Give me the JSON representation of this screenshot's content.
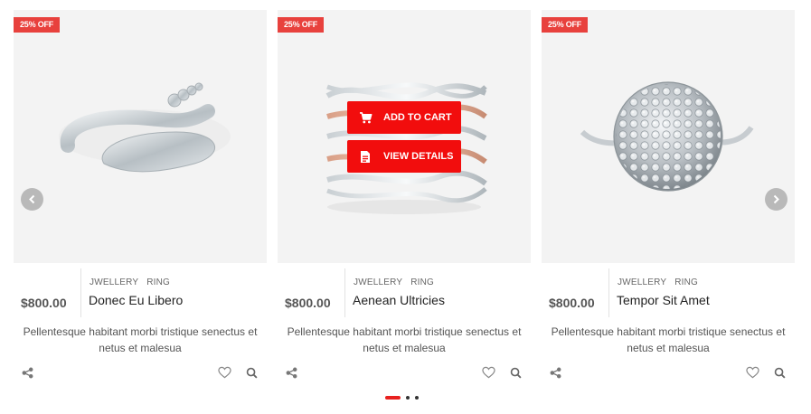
{
  "products": [
    {
      "badge": "25% OFF",
      "price": "$800.00",
      "categories": [
        "JWELLERY",
        "RING"
      ],
      "name": "Donec Eu Libero",
      "description": "Pellentesque habitant morbi tristique senectus et netus et malesua",
      "image": "silver-snake-ring"
    },
    {
      "badge": "25% OFF",
      "price": "$800.00",
      "categories": [
        "JWELLERY",
        "RING"
      ],
      "name": "Aenean Ultricies",
      "description": "Pellentesque habitant morbi tristique senectus et netus et malesua",
      "image": "wave-band-ring",
      "hover_buttons": {
        "add_to_cart": "ADD TO CART",
        "view_details": "VIEW DETAILS"
      }
    },
    {
      "badge": "25% OFF",
      "price": "$800.00",
      "categories": [
        "JWELLERY",
        "RING"
      ],
      "name": "Tempor Sit Amet",
      "description": "Pellentesque habitant morbi tristique senectus et netus et malesua",
      "image": "diamond-dome-ring"
    }
  ],
  "icons": {
    "share": "share-icon",
    "wishlist": "heart-icon",
    "quickview": "search-icon",
    "prev": "chevron-left-icon",
    "next": "chevron-right-icon",
    "cart": "cart-icon",
    "details": "document-icon"
  },
  "carousel": {
    "pages": 3,
    "active_page": 1
  },
  "colors": {
    "badge": "#e8413d",
    "button": "#f20d0d",
    "active_dot": "#e8211f"
  }
}
